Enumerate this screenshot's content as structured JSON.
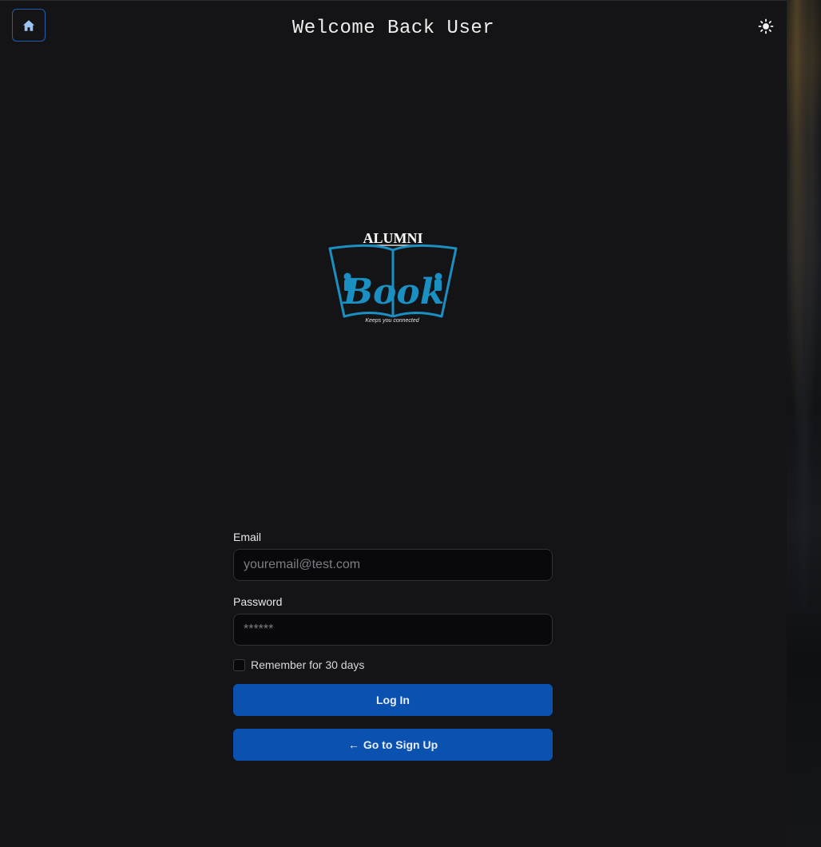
{
  "header": {
    "title": "Welcome Back User",
    "home_icon": "home-icon",
    "theme_icon": "sun-icon"
  },
  "logo": {
    "top_text": "ALUMNI",
    "main_text": "Book",
    "tagline": "Keeps you connected"
  },
  "form": {
    "email_label": "Email",
    "email_placeholder": "youremail@test.com",
    "password_label": "Password",
    "password_placeholder": "******",
    "remember_label": "Remember for 30 days",
    "login_label": "Log In",
    "signup_arrow": "←",
    "signup_label": "Go to Sign Up"
  },
  "colors": {
    "background": "#141417",
    "primary_button": "#0b51b0",
    "logo_blue": "#1a8fc2",
    "home_border": "#1f5fae"
  }
}
